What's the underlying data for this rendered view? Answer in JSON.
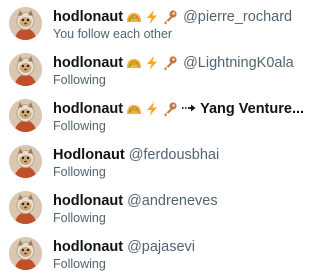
{
  "users": [
    {
      "name": "hodlonaut",
      "handle": "@pierre_rochard",
      "status": "You follow each other",
      "emojis": [
        "taco-emoji",
        "lightning-emoji",
        "key-emoji"
      ],
      "extra": ""
    },
    {
      "name": "hodlonaut",
      "handle": "@LightningK0ala",
      "status": "Following",
      "emojis": [
        "taco-emoji",
        "lightning-emoji",
        "key-emoji"
      ],
      "extra": ""
    },
    {
      "name": "hodlonaut",
      "handle": "",
      "status": "Following",
      "emojis": [
        "taco-emoji",
        "lightning-emoji",
        "key-emoji"
      ],
      "extra": "Yang Venture..."
    },
    {
      "name": "Hodlonaut",
      "handle": "@ferdousbhai",
      "status": "Following",
      "emojis": [],
      "extra": ""
    },
    {
      "name": "hodlonaut",
      "handle": "@andreneves",
      "status": "Following",
      "emojis": [],
      "extra": ""
    },
    {
      "name": "hodlonaut",
      "handle": "@pajasevi",
      "status": "Following",
      "emojis": [],
      "extra": ""
    }
  ],
  "colors": {
    "name": "#0f1419",
    "secondary": "#536471",
    "background": "#ffffff"
  }
}
